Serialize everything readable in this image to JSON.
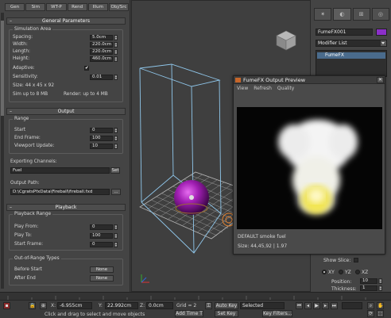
{
  "left_panel": {
    "tabs": [
      "Gen",
      "Sim",
      "WT-P",
      "Rend",
      "Illum",
      "Obj/Src"
    ],
    "general": {
      "title": "General Parameters",
      "sim_area_title": "Simulation Area",
      "spacing_label": "Spacing:",
      "spacing_value": "5.0cm",
      "width_label": "Width:",
      "width_value": "220.0cm",
      "length_label": "Length:",
      "length_value": "220.0cm",
      "height_label": "Height:",
      "height_value": "460.0cm",
      "adaptive_label": "Adaptive:",
      "adaptive_check": "✔",
      "sensitivity_label": "Sensitivity:",
      "sensitivity_value": "0.01",
      "size_text": "Size: 44 x 45 x 92",
      "sim_up_to": "Sim up to 8 MB",
      "render_up_to": "Render: up to 4 MB"
    },
    "output": {
      "title": "Output",
      "range_title": "Range",
      "start_label": "Start",
      "start_value": "0",
      "end_label": "End Frame:",
      "end_value": "100",
      "viewport_label": "Viewport Update:",
      "viewport_value": "10",
      "exporting_label": "Exporting Channels:",
      "exporting_value": "Fuel",
      "set_label": "Set",
      "path_label": "Output Path:",
      "path_value": "D:\\CgratsPfxData\\Fireball\\fireball.fxd",
      "browse_label": "..."
    },
    "playback": {
      "title": "Playback",
      "range_title": "Playback Range",
      "from_label": "Play From:",
      "from_value": "0",
      "to_label": "Play To:",
      "to_value": "100",
      "startframe_label": "Start Frame:",
      "startframe_value": "0",
      "oor_title": "Out-of-Range Types",
      "before_label": "Before Start",
      "before_value": "None",
      "after_label": "After End",
      "after_value": "None"
    }
  },
  "right_panel": {
    "object_name": "FumeFX001",
    "object_color": "#8b2fc9",
    "modifier_list": "Modifier List",
    "stack_item": "FumeFX",
    "show_slice_label": "Show Slice:",
    "radio_labels": [
      "XY",
      "YZ",
      "XZ"
    ],
    "position_label": "Position:",
    "position_value": "10",
    "thickness_label": "Thickness:",
    "thickness_value": "1"
  },
  "preview_window": {
    "title": "FumeFX Output Preview",
    "menu": [
      "View",
      "Refresh",
      "Quality"
    ],
    "caption": "DEFAULT smoke fuel",
    "size_text": "Size: 44,45,92 | 1.97"
  },
  "status_bar": {
    "x_label": "X:",
    "x_value": "-6.955cm",
    "y_label": "Y:",
    "y_value": "22.992cm",
    "z_label": "Z:",
    "z_value": "0.0cm",
    "grid_text": "Grid = 2",
    "autokey_label": "Auto Key",
    "selected_value": "Selected",
    "setkey_label": "Set Key",
    "keyfilters_label": "Key Filters...",
    "prompt_text": "Click and drag to select and move objects",
    "add_time_tag": "Add Time T"
  }
}
